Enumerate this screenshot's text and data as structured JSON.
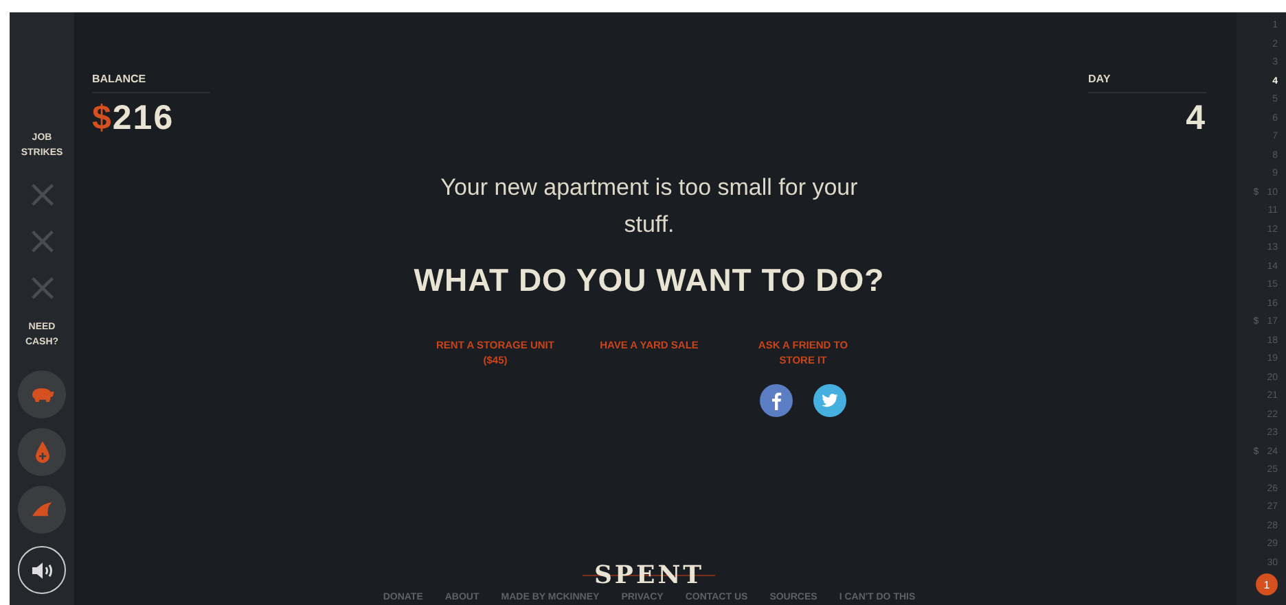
{
  "sidebar": {
    "strikes_label": "JOB STRIKES",
    "strikes": [
      {
        "struck": false
      },
      {
        "struck": false
      },
      {
        "struck": false
      }
    ],
    "cash_label": "NEED CASH?",
    "cash_options": [
      {
        "kind": "pig"
      },
      {
        "kind": "drop"
      },
      {
        "kind": "fin"
      }
    ],
    "sound": {
      "on": true
    }
  },
  "balance": {
    "label": "BALANCE",
    "currency": "$",
    "amount": "216"
  },
  "day": {
    "label": "DAY",
    "value": "4"
  },
  "message": "Your new apartment is too small for your stuff.",
  "question": "WHAT DO YOU WANT TO DO?",
  "choices": [
    "RENT A STORAGE UNIT ($45)",
    "HAVE A YARD SALE",
    "ASK A FRIEND TO STORE IT"
  ],
  "share": [
    {
      "kind": "facebook"
    },
    {
      "kind": "twitter"
    }
  ],
  "footer": {
    "logo": "SPENT",
    "links": [
      "DONATE",
      "ABOUT",
      "MADE BY MCKINNEY",
      "PRIVACY",
      "CONTACT US",
      "SOURCES",
      "I CAN'T DO THIS"
    ]
  },
  "calendar": {
    "days": [
      {
        "label": "1",
        "selected": false,
        "payday": false
      },
      {
        "label": "2",
        "selected": false,
        "payday": false
      },
      {
        "label": "3",
        "selected": false,
        "payday": false
      },
      {
        "label": "4",
        "selected": true,
        "payday": false
      },
      {
        "label": "5",
        "selected": false,
        "payday": false
      },
      {
        "label": "6",
        "selected": false,
        "payday": false
      },
      {
        "label": "7",
        "selected": false,
        "payday": false
      },
      {
        "label": "8",
        "selected": false,
        "payday": false
      },
      {
        "label": "9",
        "selected": false,
        "payday": false
      },
      {
        "label": "10",
        "selected": false,
        "payday": true
      },
      {
        "label": "11",
        "selected": false,
        "payday": false
      },
      {
        "label": "12",
        "selected": false,
        "payday": false
      },
      {
        "label": "13",
        "selected": false,
        "payday": false
      },
      {
        "label": "14",
        "selected": false,
        "payday": false
      },
      {
        "label": "15",
        "selected": false,
        "payday": false
      },
      {
        "label": "16",
        "selected": false,
        "payday": false
      },
      {
        "label": "17",
        "selected": false,
        "payday": true
      },
      {
        "label": "18",
        "selected": false,
        "payday": false
      },
      {
        "label": "19",
        "selected": false,
        "payday": false
      },
      {
        "label": "20",
        "selected": false,
        "payday": false
      },
      {
        "label": "21",
        "selected": false,
        "payday": false
      },
      {
        "label": "22",
        "selected": false,
        "payday": false
      },
      {
        "label": "23",
        "selected": false,
        "payday": false
      },
      {
        "label": "24",
        "selected": false,
        "payday": true
      },
      {
        "label": "25",
        "selected": false,
        "payday": false
      },
      {
        "label": "26",
        "selected": false,
        "payday": false
      },
      {
        "label": "27",
        "selected": false,
        "payday": false
      },
      {
        "label": "28",
        "selected": false,
        "payday": false
      },
      {
        "label": "29",
        "selected": false,
        "payday": false
      },
      {
        "label": "30",
        "selected": false,
        "payday": false
      }
    ],
    "payday_mark": "$",
    "badge": "1"
  }
}
